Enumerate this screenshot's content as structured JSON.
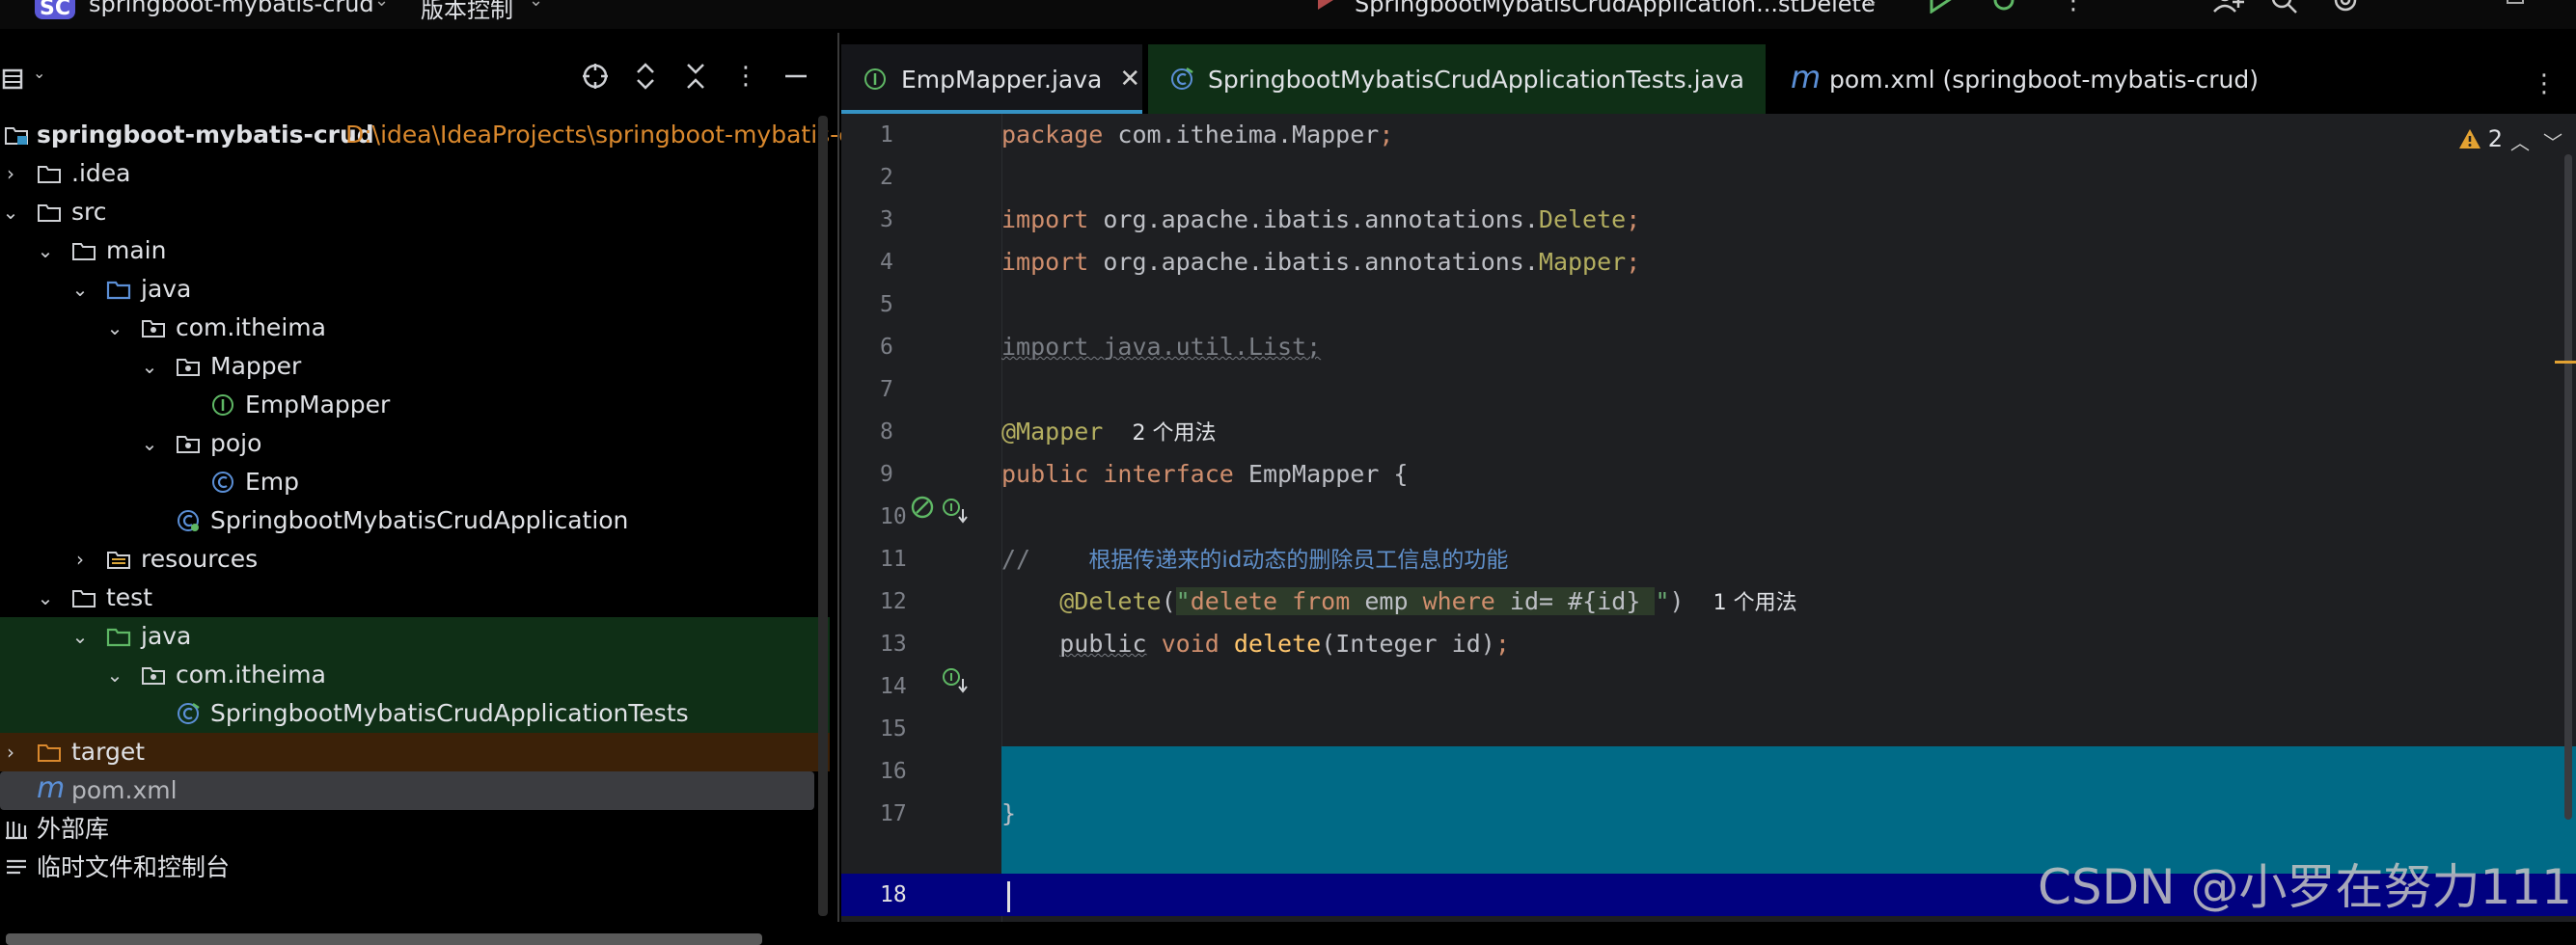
{
  "titlebar": {
    "project_badge": "SC",
    "project_name": "springboot-mybatis-crud",
    "vcs": "版本控制",
    "run_config": "SpringbootMybatisCrudApplication...stDelete"
  },
  "project_tree": {
    "root_name": "springboot-mybatis-crud",
    "root_path": "D:\\idea\\IdeaProjects\\springboot-mybatis-c",
    "items": [
      {
        "label": "springboot-mybatis-crud"
      },
      {
        "label": ".idea"
      },
      {
        "label": "src"
      },
      {
        "label": "main"
      },
      {
        "label": "java"
      },
      {
        "label": "com.itheima"
      },
      {
        "label": "Mapper"
      },
      {
        "label": "EmpMapper"
      },
      {
        "label": "pojo"
      },
      {
        "label": "Emp"
      },
      {
        "label": "SpringbootMybatisCrudApplication"
      },
      {
        "label": "resources"
      },
      {
        "label": "test"
      },
      {
        "label": "java"
      },
      {
        "label": "com.itheima"
      },
      {
        "label": "SpringbootMybatisCrudApplicationTests"
      },
      {
        "label": "target"
      },
      {
        "label": "pom.xml"
      },
      {
        "label": "外部库"
      },
      {
        "label": "临时文件和控制台"
      }
    ]
  },
  "tabs": [
    {
      "label": "EmpMapper.java"
    },
    {
      "label": "SpringbootMybatisCrudApplicationTests.java"
    },
    {
      "label": "pom.xml (springboot-mybatis-crud)"
    }
  ],
  "editor": {
    "warning_count": "2",
    "line_numbers": [
      "1",
      "2",
      "3",
      "4",
      "5",
      "6",
      "7",
      "8",
      "9",
      "10",
      "11",
      "12",
      "13",
      "14",
      "15",
      "16",
      "17",
      "18"
    ],
    "code": {
      "l1_kw": "package",
      "l1_rest": " com.itheima.Mapper",
      "l1_semi": ";",
      "l3_kw": "import",
      "l3_pkg": " org.apache.ibatis.annotations.",
      "l3_cls": "Delete",
      "l3_semi": ";",
      "l4_kw": "import",
      "l4_pkg": " org.apache.ibatis.annotations.",
      "l4_cls": "Mapper",
      "l4_semi": ";",
      "l6": "import java.util.List;",
      "l8_ann": "@Mapper",
      "l8_hint": "2 个用法",
      "l9_kw1": "public",
      "l9_kw2": "interface",
      "l9_name": "EmpMapper {",
      "l11_cmt": "//",
      "l11_text": "根据传递来的id动态的删除员工信息的功能",
      "l12_ann": "@Delete",
      "l12_open": "(",
      "l12_q1": "\"",
      "l12_kw1": "delete",
      "l12_kw2": "from",
      "l12_t1": "emp",
      "l12_kw3": "where",
      "l12_t2": "id",
      "l12_t3": "= #{id} ",
      "l12_q2": "\"",
      "l12_close": ")",
      "l12_hint": "1 个用法",
      "l13_kw1": "public",
      "l13_kw2": "void",
      "l13_fn": "delete",
      "l13_params": "(Integer id)",
      "l13_semi": ";",
      "l17": "}"
    }
  },
  "watermark": "CSDN @小罗在努力111"
}
